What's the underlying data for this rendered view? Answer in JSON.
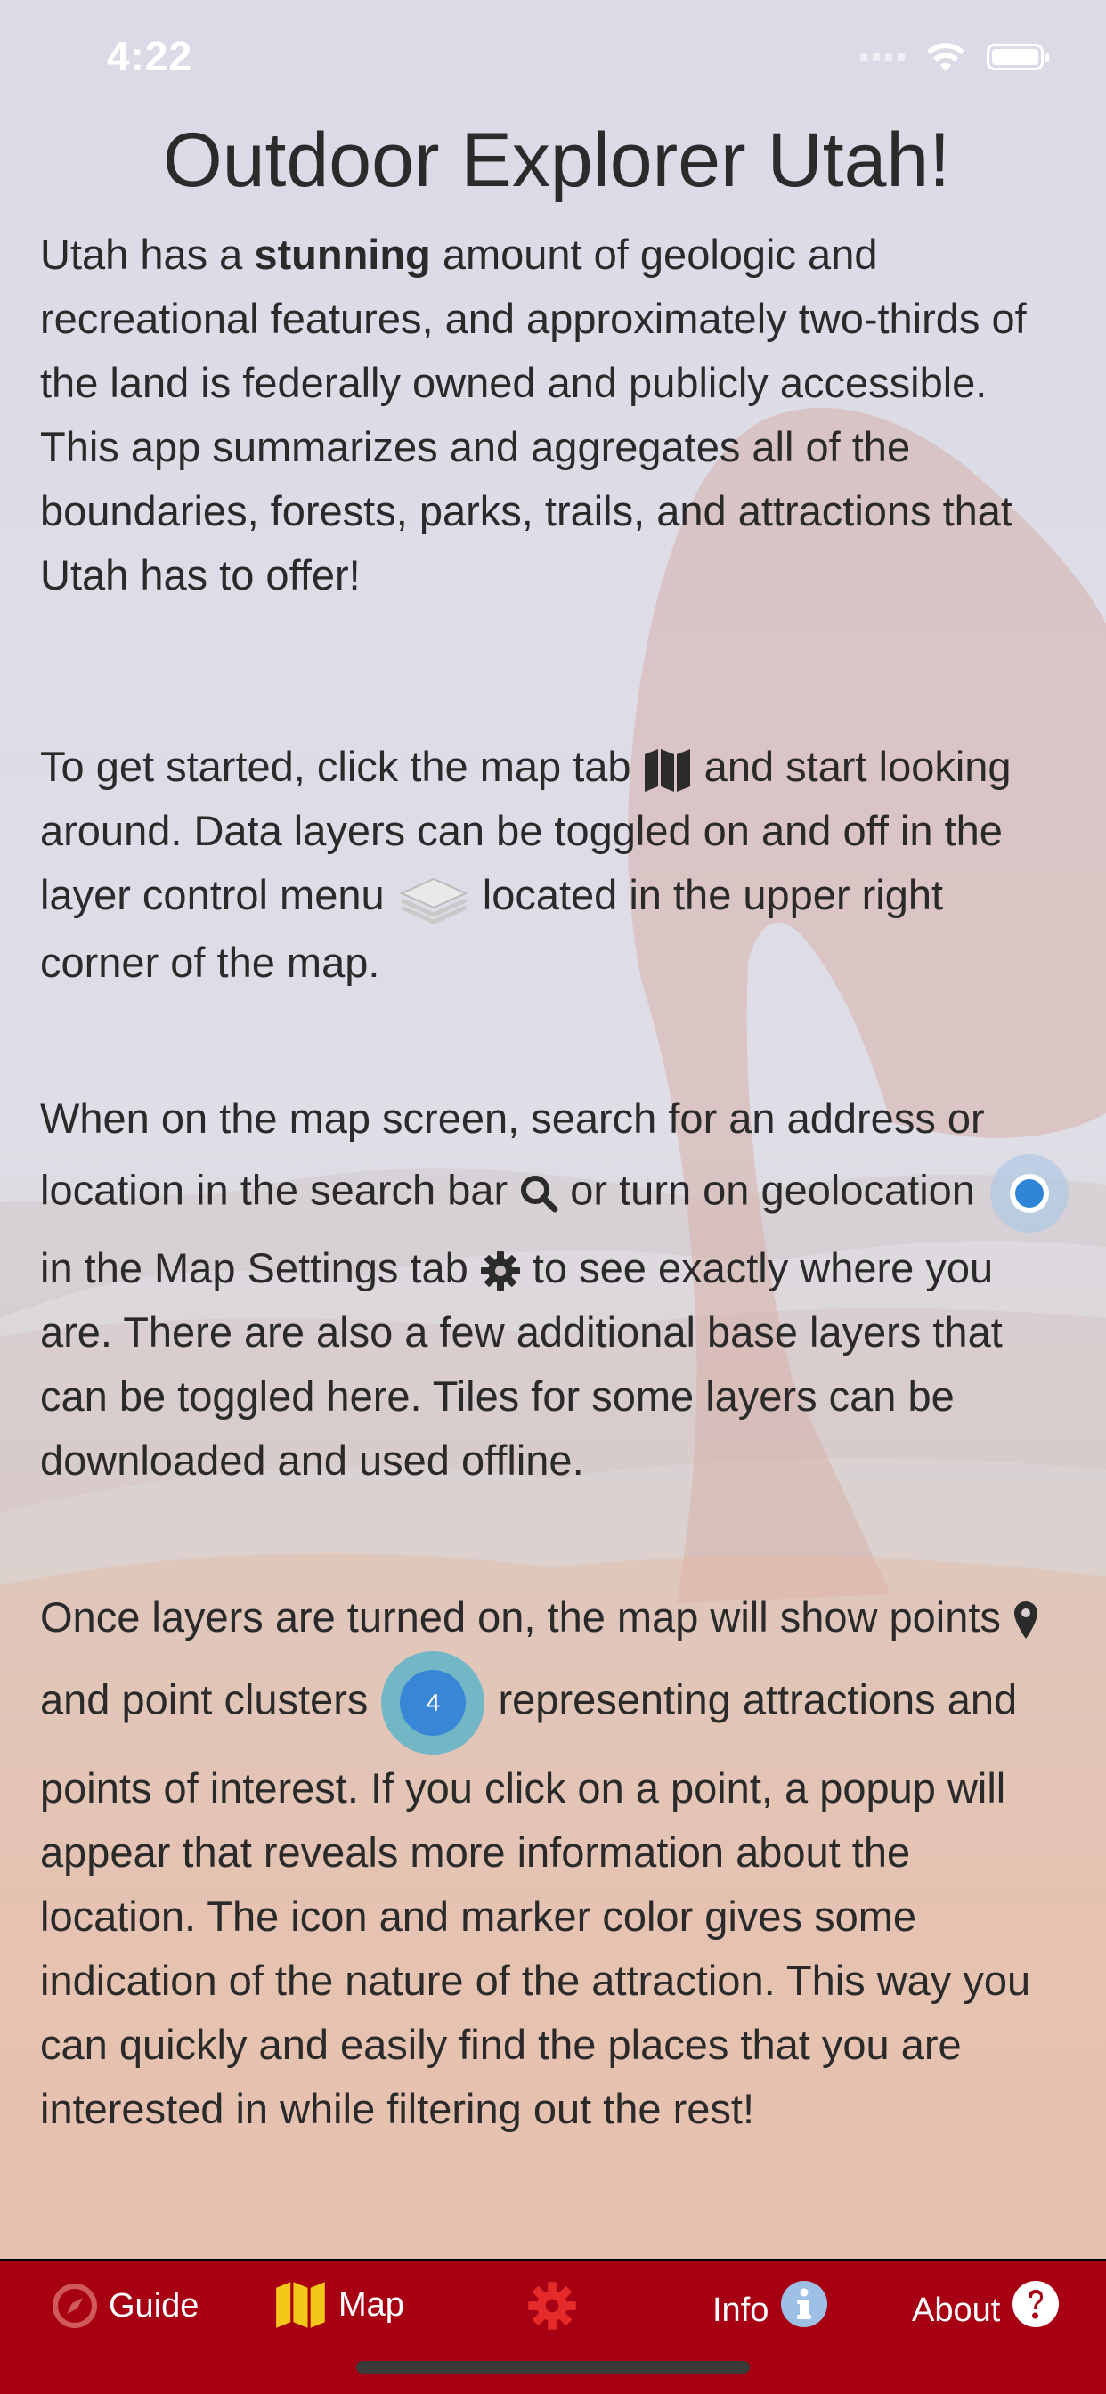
{
  "status_bar": {
    "time": "4:22"
  },
  "title": "Outdoor Explorer Utah!",
  "intro": {
    "part1": "Utah has a ",
    "bold": "stunning",
    "part2": " amount of geologic and recreational features, and approximately two-thirds of the land is federally owned and publicly accessible. This app summarizes and aggregates all of the boundaries, forests, parks, trails, and attractions that Utah has to offer!"
  },
  "getting_started": {
    "part1": "To get started, click the map tab ",
    "part2": " and start looking around. Data layers can be toggled on and off in the layer control menu ",
    "part3": " located in the upper right corner of the map."
  },
  "map_screen": {
    "part1": "When on the map screen, search for an address or location in the search bar ",
    "part2": " or turn on geolocation ",
    "part3": " in the Map Settings tab ",
    "part4": " to see exactly where you are. There are also a few additional base layers that can be toggled here. Tiles for some layers can be downloaded and used offline."
  },
  "layers": {
    "part1": "Once layers are turned on, the map will show points ",
    "part2": " and point clusters ",
    "cluster_count": "4",
    "part3": " representing attractions and points of interest. If you click on a point, a popup will appear that reveals more information about the location. The icon and marker color gives some indication of the nature of the attraction. This way you can quickly and easily find the places that you are interested in while filtering out the rest!"
  },
  "tabs": [
    {
      "label": "Guide",
      "icon": "compass-icon"
    },
    {
      "label": "Map",
      "icon": "map-icon"
    },
    {
      "label": "",
      "icon": "gear-icon"
    },
    {
      "label": "Info",
      "icon": "info-icon"
    },
    {
      "label": "About",
      "icon": "question-icon"
    }
  ],
  "colors": {
    "nav_background": "#a70012",
    "accent_yellow": "#f2c81a",
    "text": "#2a2a2a"
  }
}
